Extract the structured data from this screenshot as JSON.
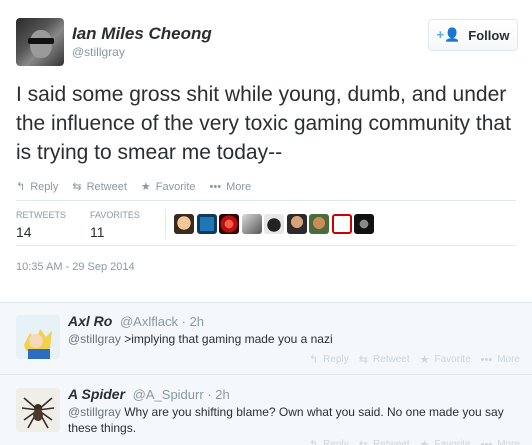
{
  "author": {
    "name": "Ian Miles Cheong",
    "handle": "@stillgray"
  },
  "follow_button": {
    "label": "Follow",
    "icon": "add-user-icon"
  },
  "tweet": {
    "text": "I said some gross shit while young, dumb, and under the influence of the very toxic gaming community that is trying to smear me today--",
    "actions": [
      {
        "label": "Reply",
        "icon": "reply-icon"
      },
      {
        "label": "Retweet",
        "icon": "retweet-icon"
      },
      {
        "label": "Favorite",
        "icon": "star-icon"
      },
      {
        "label": "More",
        "icon": "more-icon"
      }
    ],
    "stats": {
      "retweets_label": "RETWEETS",
      "retweets": "14",
      "favorites_label": "FAVORITES",
      "favorites": "11"
    },
    "timestamp": "10:35 AM - 29 Sep 2014"
  },
  "replies": [
    {
      "name": "Axl Ro",
      "handle": "@Axlflack",
      "time": "· 2h",
      "mention": "@stillgray",
      "text": " >implying that gaming made you a nazi"
    },
    {
      "name": "A Spider",
      "handle": "@A_Spidurr",
      "time": "· 2h",
      "mention": "@stillgray",
      "text": " Why are you shifting blame? Own what you said. No one made you say these things."
    }
  ],
  "reply_actions": [
    "Reply",
    "Retweet",
    "Favorite",
    "More"
  ],
  "colors": {
    "accent": "#55acee",
    "text": "#292f33",
    "muted": "#8899a6",
    "border": "#e1e8ed"
  }
}
